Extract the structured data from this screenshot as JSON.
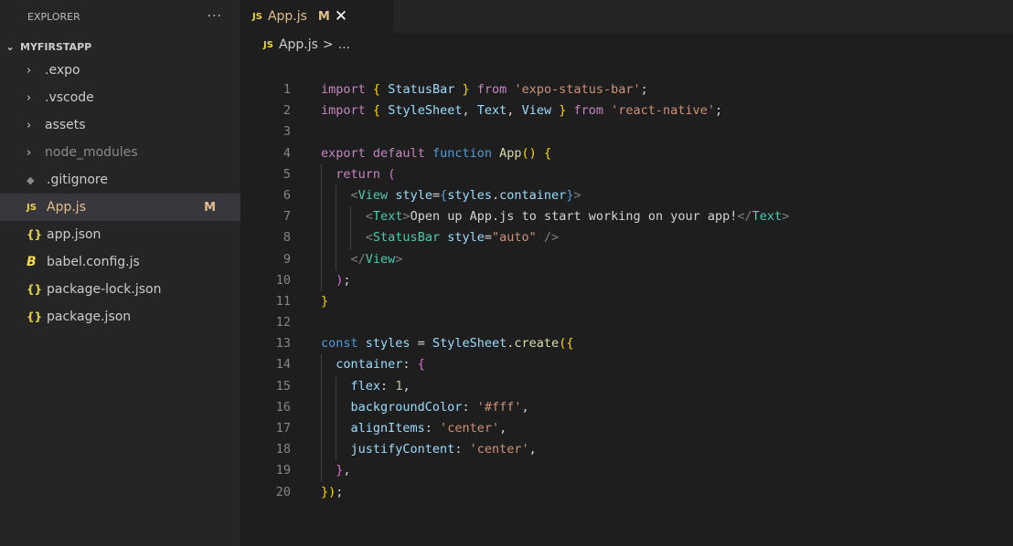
{
  "explorer": {
    "title": "EXPLORER",
    "more_label": "···",
    "root": "MYFIRSTAPP",
    "items": [
      {
        "label": ".expo",
        "kind": "folder"
      },
      {
        "label": ".vscode",
        "kind": "folder"
      },
      {
        "label": "assets",
        "kind": "folder"
      },
      {
        "label": "node_modules",
        "kind": "folder"
      },
      {
        "label": ".gitignore",
        "kind": "file"
      },
      {
        "label": "App.js",
        "kind": "file",
        "badge": "M"
      },
      {
        "label": "app.json",
        "kind": "file"
      },
      {
        "label": "babel.config.js",
        "kind": "file"
      },
      {
        "label": "package-lock.json",
        "kind": "file"
      },
      {
        "label": "package.json",
        "kind": "file"
      }
    ]
  },
  "tab": {
    "icon": "JS",
    "label": "App.js",
    "status": "M",
    "close": "✕"
  },
  "breadcrumb": {
    "icon": "JS",
    "file": "App.js",
    "sep": ">",
    "rest": "..."
  },
  "icons": {
    "js": "JS",
    "json": "{}",
    "babel": "B",
    "git": "◆",
    "chevron_right": "›",
    "chevron_down": "⌄"
  },
  "code": {
    "line_numbers": [
      "1",
      "2",
      "3",
      "4",
      "5",
      "6",
      "7",
      "8",
      "9",
      "10",
      "11",
      "12",
      "13",
      "14",
      "15",
      "16",
      "17",
      "18",
      "19",
      "20"
    ],
    "lines": [
      "import { StatusBar } from 'expo-status-bar';",
      "import { StyleSheet, Text, View } from 'react-native';",
      "",
      "export default function App() {",
      "  return (",
      "    <View style={styles.container}>",
      "      <Text>Open up App.js to start working on your app!</Text>",
      "      <StatusBar style=\"auto\" />",
      "    </View>",
      "  );",
      "}",
      "",
      "const styles = StyleSheet.create({",
      "  container: {",
      "    flex: 1,",
      "    backgroundColor: '#fff',",
      "    alignItems: 'center',",
      "    justifyContent: 'center',",
      "  },",
      "});"
    ]
  },
  "colors": {
    "background": "#1e1e1e",
    "sidebar": "#252526",
    "modified": "#e2c08d"
  }
}
